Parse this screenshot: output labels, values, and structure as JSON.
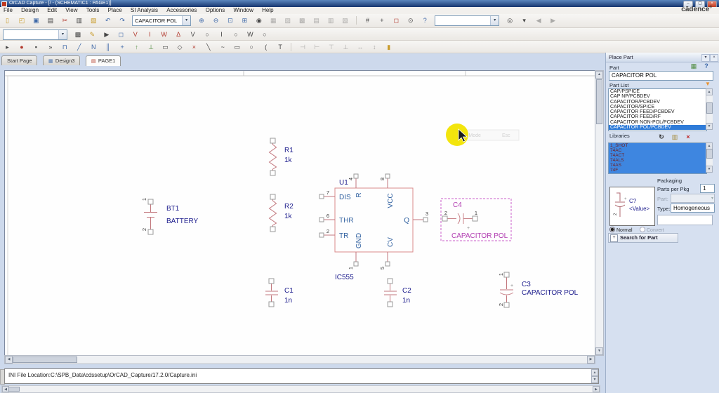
{
  "window": {
    "title": "OrCAD Capture - [/ - (SCHEMATIC1 : PAGE1)]",
    "brand": "cādence",
    "brand_reg": "®",
    "min": "–",
    "max": "▢",
    "close": "×"
  },
  "menu": {
    "items": [
      "File",
      "Design",
      "Edit",
      "View",
      "Tools",
      "Place",
      "SI Analysis",
      "Accessories",
      "Options",
      "Window",
      "Help"
    ]
  },
  "toolbar": {
    "part_combo": "CAPACITOR POL",
    "search_combo": ""
  },
  "tabs": {
    "start": "Start Page",
    "design": "Design3",
    "page": "PAGE1"
  },
  "icons": {
    "combo_arrow": "▾",
    "new": "▯",
    "open": "◰",
    "save": "▣",
    "print": "▤",
    "cut": "✂",
    "copy": "▥",
    "paste": "▧",
    "undo": "↶",
    "redo": "↷",
    "zoom_in": "⊕",
    "zoom_out": "⊖",
    "zoom_area": "⊡",
    "zoom_all": "⊞",
    "fisheye": "◉",
    "hier1": "▦",
    "hier2": "▨",
    "hier3": "▩",
    "doc1": "▤",
    "doc2": "▥",
    "doc3": "▧",
    "snap": "#",
    "pan": "+",
    "sel_area": "◻",
    "zoom_sel": "⊙",
    "help": "?",
    "find": "◎",
    "drop": "▾",
    "prev": "◀",
    "next": "▶",
    "sim_new": "▩",
    "sim_edit": "✎",
    "run": "▶",
    "results": "◻",
    "mk_v": "V",
    "mk_i": "I",
    "mk_w": "W",
    "mk_d": "Δ",
    "bias_v": "V",
    "bias_i": "I",
    "bias_w": "W",
    "bias_t": "○",
    "r3_1": "▸",
    "r3_2": "●",
    "r3_3": "▪",
    "r3_4": "»",
    "r3_5": "⊓",
    "r3_6": "╱",
    "r3_7": "N",
    "r3_8": "║",
    "r3_9": "+",
    "r3_10": "↑",
    "r3_11": "⊥",
    "r3_12": "▭",
    "r3_13": "◇",
    "r3_14": "×",
    "r3_15": "╲",
    "r3_16": "~",
    "r3_17": "▭",
    "r3_18": "○",
    "r3_19": "(",
    "r3_20": "T",
    "al_l": "⊣",
    "al_r": "⊢",
    "al_t": "⊤",
    "al_b": "⊥",
    "dist_h": "↔",
    "dist_v": "↕",
    "hl": "▮",
    "panel_part": "▦",
    "panel_help": "?",
    "filter": "▼",
    "refresh": "↻",
    "lib_add": "▥",
    "lib_del": "×",
    "pin": "▾",
    "close": "×",
    "sb_up": "▲",
    "sb_dn": "▼",
    "sb_l": "◀",
    "sb_r": "▶",
    "plus": "+",
    "tab_design": "▦",
    "tab_page": "▤"
  },
  "sch": {
    "bt1_ref": "BT1",
    "bt1_val": "BATTERY",
    "bt1_p1": "1",
    "bt1_p2": "2",
    "r1_ref": "R1",
    "r1_val": "1k",
    "r2_ref": "R2",
    "r2_val": "1k",
    "u1_ref": "U1",
    "u1_val": "IC555",
    "u1_p7": "7",
    "u1_p6": "6",
    "u1_p2": "2",
    "u1_p4": "4",
    "u1_p8": "8",
    "u1_p3": "3",
    "u1_p1": "1",
    "u1_p5": "5",
    "u1_dis": "DIS",
    "u1_thr": "THR",
    "u1_tr": "TR",
    "u1_r": "R",
    "u1_vcc": "VCC",
    "u1_q": "Q",
    "u1_gnd": "GND",
    "u1_cv": "CV",
    "c4_ref": "C4",
    "c4_val": "CAPACITOR POL",
    "c4_p2": "2",
    "c4_p1": "1",
    "c4_plus": "+",
    "c1_ref": "C1",
    "c1_val": "1n",
    "c2_ref": "C2",
    "c2_val": "1n",
    "c3_ref": "C3",
    "c3_val": "CAPACITOR POL",
    "c3_p1": "1",
    "c3_p2": "2",
    "c3_plus": "+",
    "tooltip_text": "End Mode",
    "tooltip_esc": "Esc"
  },
  "place_part": {
    "title": "Place Part",
    "part_label": "Part",
    "part_value": "CAPACITOR POL",
    "part_list_label": "Part List",
    "part_list": [
      "CAP/PSPICE",
      "CAP NP/PCBDEV",
      "CAPACITOR/PCBDEV",
      "CAPACITOR/SPICE",
      "CAPACITOR FEED/PCBDEV",
      "CAPACITOR FEED/RF",
      "CAPACITOR NON-POL/PCBDEV",
      "CAPACITOR POL/PCBDEV"
    ],
    "selected_part": "CAPACITOR POL/PCBDEV",
    "libraries_label": "Libraries",
    "libraries": [
      "1_SHOT",
      "74AC",
      "74ACT",
      "74ALS",
      "74AS",
      "74F"
    ],
    "preview_ref": "C?",
    "preview_value": "<Value>",
    "preview_p2": "2",
    "packaging_title": "Packaging",
    "ppp_label": "Parts per Pkg",
    "ppp_value": "1",
    "pkg_part_label": "Part:",
    "type_label": "Type:",
    "type_value": "Homogeneous",
    "normal_label": "Normal",
    "convert_label": "Convert",
    "search_label": "Search for Part"
  },
  "status": {
    "ini": "INI File Location:C:\\SPB_Data\\cdssetup\\OrCAD_Capture/17.2.0/Capture.ini"
  }
}
